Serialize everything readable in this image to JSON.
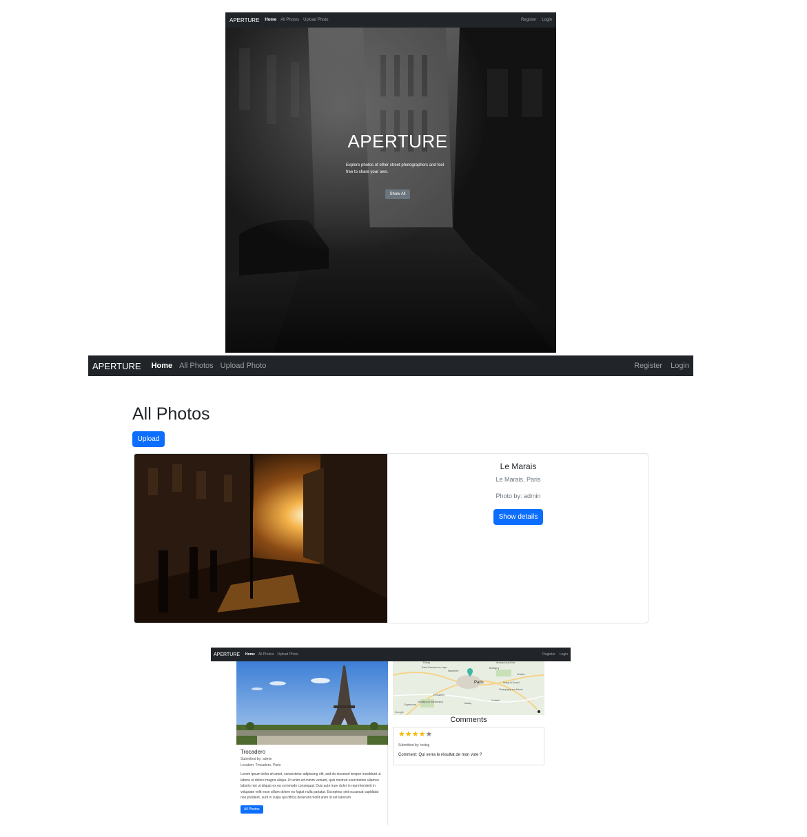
{
  "brand": "APERTURE",
  "nav": {
    "home": "Home",
    "all_photos": "All Photos",
    "upload_photo": "Upload Photo",
    "register": "Register",
    "login": "Login"
  },
  "hero": {
    "title": "APERTURE",
    "subtitle": "Explore photos of other street photographers and feel free to share your own.",
    "button": "Show All"
  },
  "all_photos_page": {
    "title": "All Photos",
    "upload_button": "Upload",
    "card": {
      "title": "Le Marais",
      "location": "Le Marais, Paris",
      "photo_by": "Photo by: admin",
      "button": "Show details"
    }
  },
  "detail_page": {
    "title": "Trocadero",
    "submitted_by": "Submitted by: admin",
    "location": "Location: Trocadero, Paris",
    "description": "Lorem ipsum dolor sit amet, consectetur adipiscing elit, sed do eiusmod tempor incididunt ut labore et dolore magna aliqua. Ut enim ad minim veniam, quis nostrud exercitation ullamco laboris nisi ut aliquip ex ea commodo consequat. Duis aute irure dolor in reprehenderit in voluptate velit esse cillum dolore eu fugiat nulla pariatur. Excepteur sint occaecat cupidatat non proident, sunt in culpa qui officia deserunt mollit anim id est laborum",
    "button": "All Photos",
    "map_labels": {
      "paris": "Paris",
      "bobigny": "Bobigny",
      "nanterre": "Nanterre",
      "versailles": "Versailles",
      "creteil": "Créteil",
      "saint_germain": "Saint-Germain-en-Laye",
      "champigny": "Champigny-sur-Marne",
      "noisy": "Noisy-le-Grand",
      "poissy": "Poissy",
      "massy": "Massy",
      "chelles": "Chelles",
      "aulnay": "Aulnay-sous-Bois",
      "montigny": "Montigny-le-Bretonneux",
      "guyancourt": "Guyancourt",
      "google": "Google"
    },
    "comments_title": "Comments",
    "comment": {
      "rating": 4,
      "max_rating": 5,
      "submitted_by": "Submitted by: testsg",
      "text": "Comment: Qui verra le résultat de mon vote ?"
    },
    "colors": {
      "star_filled": "#f5b800",
      "star_empty": "#8a8a8a"
    }
  },
  "colors": {
    "navbar_bg": "#212529",
    "primary": "#0d6efd",
    "secondary_button": "#6c757d"
  }
}
